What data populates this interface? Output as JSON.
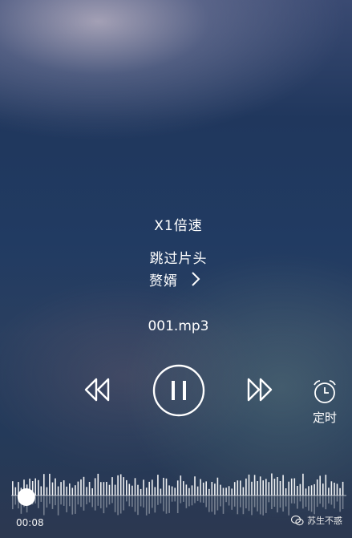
{
  "player": {
    "speed_label": "X1倍速",
    "skip_intro_label": "跳过片头",
    "artist": "赘婿",
    "filename": "001.mp3",
    "timer_label": "定时",
    "current_time": "00:08",
    "progress_fraction": 0.045
  },
  "icons": {
    "rewind": "rewind-icon",
    "pause": "pause-icon",
    "fast_forward": "fast-forward-icon",
    "alarm": "alarm-clock-icon",
    "chevron": "chevron-right-icon",
    "wechat": "wechat-icon"
  },
  "watermark": {
    "text": "苏生不惑"
  },
  "colors": {
    "foreground": "#ffffff",
    "background_top": "#3a4a72",
    "background_mid": "#213b62"
  }
}
